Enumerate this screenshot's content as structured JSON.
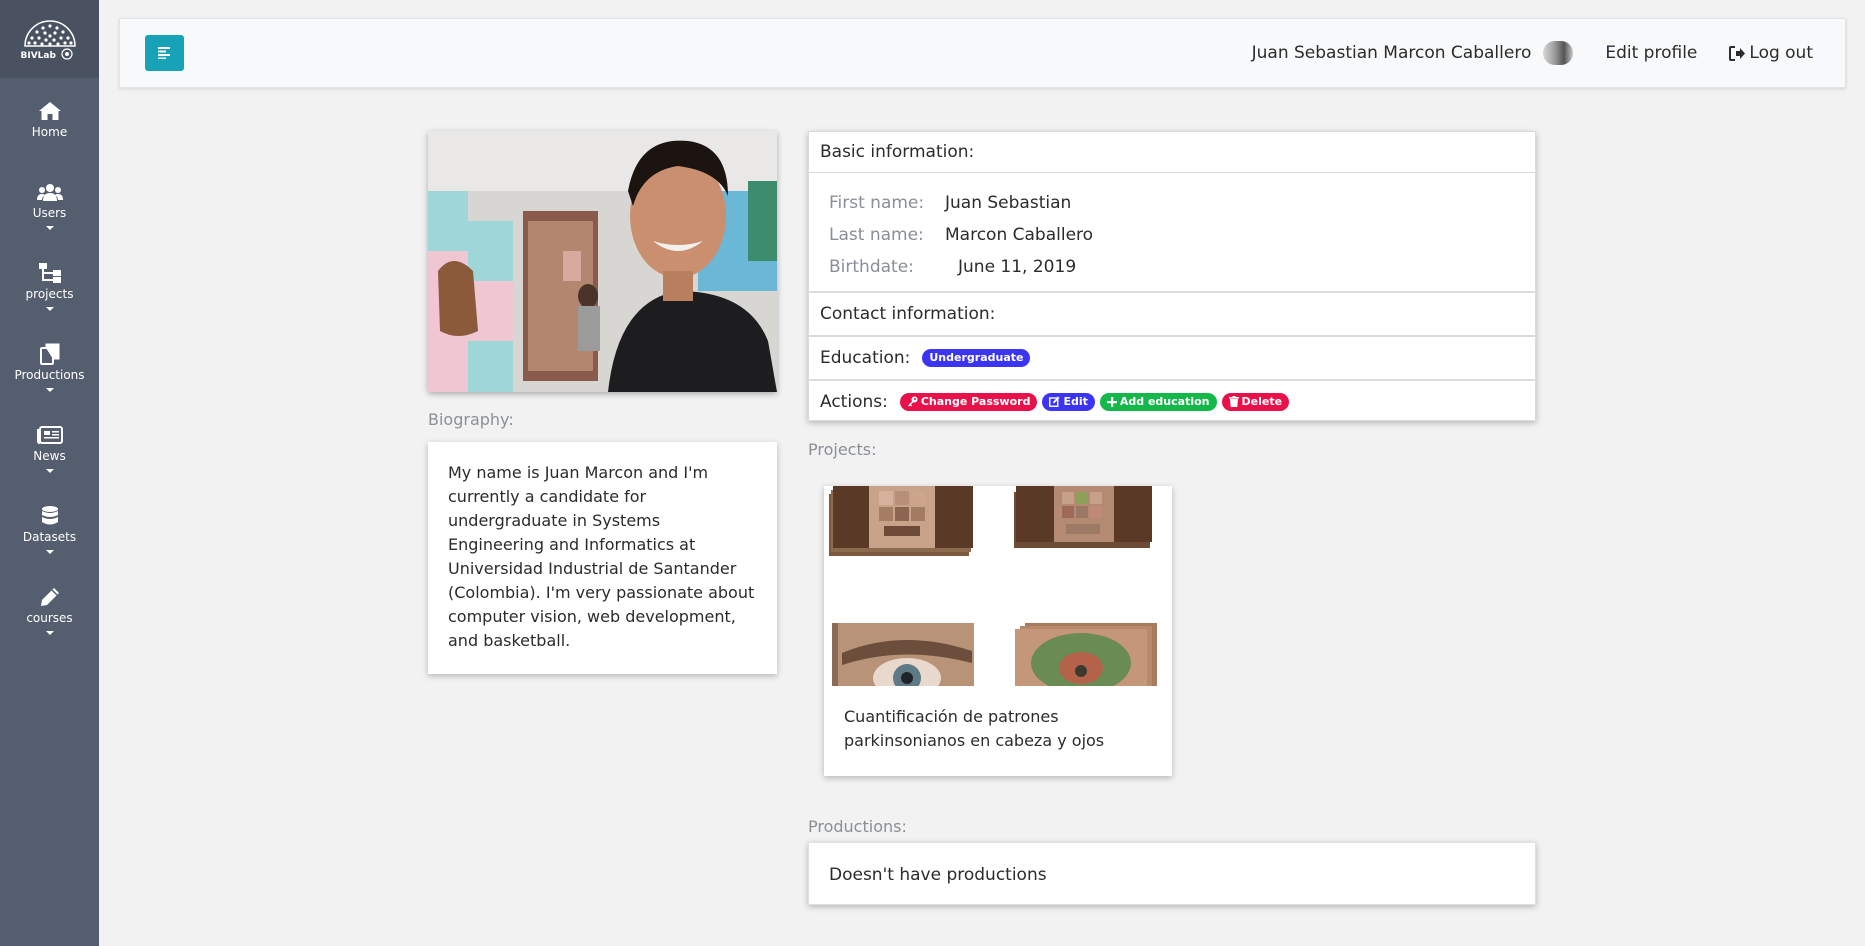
{
  "sidebar": {
    "logo_text": "BIVLab",
    "items": [
      {
        "label": "Home",
        "icon": "home-icon",
        "dropdown": false
      },
      {
        "label": "Users",
        "icon": "users-icon",
        "dropdown": true
      },
      {
        "label": "projects",
        "icon": "sitemap-icon",
        "dropdown": true
      },
      {
        "label": "Productions",
        "icon": "copy-icon",
        "dropdown": true
      },
      {
        "label": "News",
        "icon": "newspaper-icon",
        "dropdown": true
      },
      {
        "label": "Datasets",
        "icon": "database-icon",
        "dropdown": true
      },
      {
        "label": "courses",
        "icon": "pencil-icon",
        "dropdown": true
      }
    ]
  },
  "topbar": {
    "user_name": "Juan Sebastian Marcon Caballero",
    "edit_profile": "Edit profile",
    "logout": "Log out"
  },
  "profile": {
    "biography_label": "Biography:",
    "biography": "My name is Juan Marcon and I'm currently a candidate for undergraduate in Systems Engineering and Informatics at Universidad Industrial de Santander (Colombia). I'm very passionate about computer vision, web development, and basketball."
  },
  "basic_info": {
    "title": "Basic information:",
    "first_name_label": "First name:",
    "first_name": "Juan Sebastian",
    "last_name_label": "Last name:",
    "last_name": "Marcon Caballero",
    "birthdate_label": "Birthdate:",
    "birthdate": "June 11, 2019"
  },
  "contact": {
    "title": "Contact information:"
  },
  "education": {
    "title": "Education:",
    "badge": "Undergraduate"
  },
  "actions": {
    "title": "Actions:",
    "change_password": "Change Password",
    "edit": "Edit",
    "add_education": "Add education",
    "delete": "Delete"
  },
  "projects": {
    "label": "Projects:",
    "items": [
      {
        "title": "Cuantificación de patrones parkinsonianos en cabeza y ojos"
      }
    ]
  },
  "productions": {
    "label": "Productions:",
    "empty_text": "Doesn't have productions"
  },
  "colors": {
    "sidebar": "#555e6e",
    "toggle_button": "#17a2b8",
    "badge_blue": "#3b35f2",
    "badge_red": "#e8114a",
    "badge_green": "#14b84a"
  }
}
